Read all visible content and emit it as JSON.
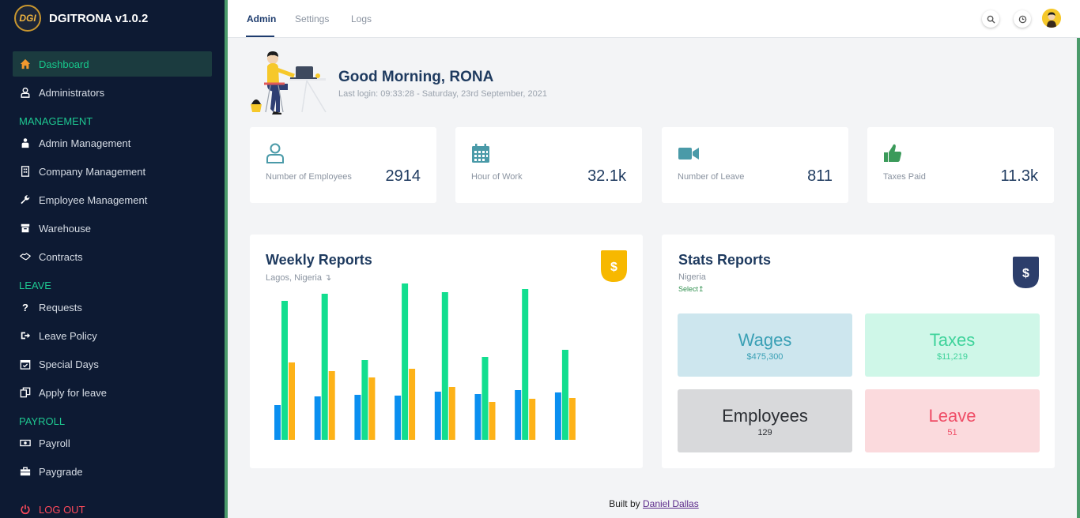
{
  "app": {
    "title": "DGITRONA v1.0.2",
    "logo_text": "DGI"
  },
  "sidebar": {
    "items": [
      {
        "label": "Dashboard",
        "icon": "home-icon"
      },
      {
        "label": "Administrators",
        "icon": "user-icon"
      },
      {
        "label": "Admin Management",
        "icon": "admin-management-icon"
      },
      {
        "label": "Company Management",
        "icon": "building-icon"
      },
      {
        "label": "Employee Management",
        "icon": "wrench-icon"
      },
      {
        "label": "Warehouse",
        "icon": "archive-icon"
      },
      {
        "label": "Contracts",
        "icon": "handshake-icon"
      },
      {
        "label": "Requests",
        "icon": "question-icon"
      },
      {
        "label": "Leave Policy",
        "icon": "sign-out-icon"
      },
      {
        "label": "Special Days",
        "icon": "calendar-check-icon"
      },
      {
        "label": "Apply for leave",
        "icon": "copy-icon"
      },
      {
        "label": "Payroll",
        "icon": "money-icon"
      },
      {
        "label": "Paygrade",
        "icon": "briefcase-icon"
      }
    ],
    "sections": [
      "MANAGEMENT",
      "LEAVE",
      "PAYROLL"
    ],
    "logout": "LOG OUT"
  },
  "topbar": {
    "tabs": [
      "Admin",
      "Settings",
      "Logs"
    ]
  },
  "greeting": {
    "title": "Good Morning, RONA",
    "last_login": "Last login: 09:33:28 - Saturday, 23rd September, 2021"
  },
  "stats": [
    {
      "label": "Number of Employees",
      "value": "2914",
      "icon": "user-outline-icon"
    },
    {
      "label": "Hour of Work",
      "value": "32.1k",
      "icon": "calendar-icon"
    },
    {
      "label": "Number of Leave",
      "value": "811",
      "icon": "video-camera-icon"
    },
    {
      "label": "Taxes Paid",
      "value": "11.3k",
      "icon": "thumbs-up-icon"
    }
  ],
  "weekly": {
    "title": "Weekly Reports",
    "subtitle": "Lagos, Nigeria",
    "badge": "$"
  },
  "chart_data": {
    "type": "bar",
    "categories": [
      "",
      "",
      "",
      "",
      "",
      "",
      "",
      ""
    ],
    "series": [
      {
        "values": [
          44,
          55,
          57,
          56,
          61,
          58,
          63,
          60
        ]
      },
      {
        "values": [
          176,
          185,
          101,
          198,
          187,
          105,
          191,
          114
        ]
      },
      {
        "values": [
          98,
          87,
          79,
          90,
          67,
          48,
          52,
          53
        ]
      }
    ],
    "series_2_extra": [],
    "colors": [
      "#0a8ff0",
      "#12de8f",
      "#fdb218"
    ],
    "grid": false,
    "legend": "none",
    "ylim": [
      0,
      200
    ]
  },
  "stats_reports": {
    "title": "Stats Reports",
    "subtitle": "Nigeria",
    "select_label": "Select",
    "badge": "$",
    "tiles": [
      {
        "name": "Wages",
        "value": "$475,300"
      },
      {
        "name": "Taxes",
        "value": "$11,219"
      },
      {
        "name": "Employees",
        "value": "129"
      },
      {
        "name": "Leave",
        "value": "51"
      }
    ]
  },
  "footer": {
    "prefix": "Built by",
    "author": "Daniel Dallas"
  },
  "colors": {
    "sidebar_bg": "#0d1a33",
    "accent_green": "#1ec891",
    "title_navy": "#1e3a5f",
    "icon_teal": "#4a9aa8",
    "logout_red": "#ff4a5b"
  }
}
